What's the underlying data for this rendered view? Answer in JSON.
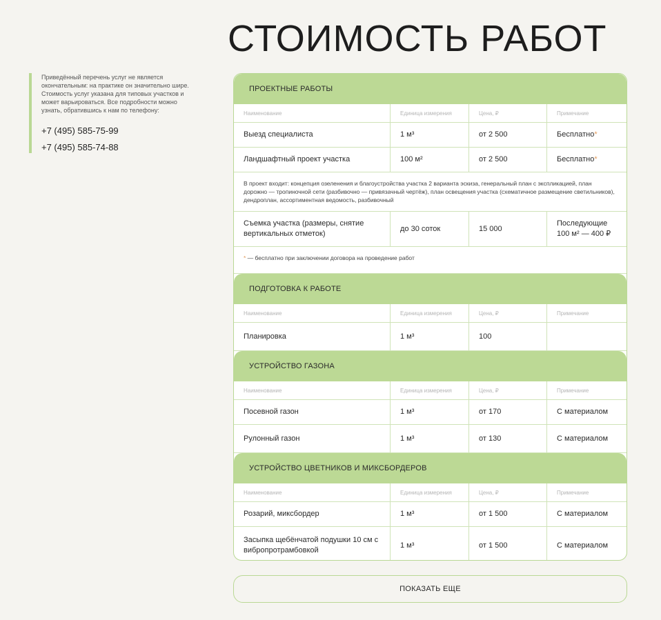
{
  "page": {
    "title": "СТОИМОСТЬ РАБОТ"
  },
  "note": {
    "text": "Приведённый перечень услуг не является окончательным: на практике он значительно шире. Стоимость услуг указана для типовых участков и может варьироваться. Все подробности можно узнать, обратившись к нам по телефону:",
    "phones": [
      "+7 (495) 585-75-99",
      "+7 (495) 585-74-88"
    ]
  },
  "table_headers": {
    "name": "Наименование",
    "unit": "Единица измерения",
    "price": "Цена, ₽",
    "note": "Примечание"
  },
  "sections": [
    {
      "title": "ПРОЕКТНЫЕ РАБОТЫ",
      "rows": [
        {
          "name": "Выезд специалиста",
          "unit": "1 м³",
          "price": "от 2 500",
          "note": "Бесплатно",
          "star": "*"
        },
        {
          "name": "Ландшафтный проект участка",
          "unit": "100 м²",
          "price": "от 2 500",
          "note": "Бесплатно",
          "star": "*"
        }
      ],
      "project_includes": "В проект входит: концепция озеленения и благоустройства участка 2 варианта эскиза, генеральный план с экспликацией, план дорожно — тропиночной сети (разбивочно — привязачный чертёж), план освещения участка (схематичное размещение светильников), дендроплан, ассортиментная ведомость, разбивочный",
      "survey_row": {
        "name": "Съемка участка (размеры, снятие вертикальных отметок)",
        "unit": "до 30 соток",
        "price": "15 000",
        "note": "Последующие 100 м² — 400 ₽"
      },
      "footnote_star": "*",
      "footnote": " — бесплатно при заключении договора на проведение работ"
    },
    {
      "title": "ПОДГОТОВКА К РАБОТЕ",
      "rows": [
        {
          "name": "Планировка",
          "unit": "1 м³",
          "price": "100",
          "note": ""
        }
      ]
    },
    {
      "title": "УСТРОЙСТВО ГАЗОНА",
      "rows": [
        {
          "name": "Посевной газон",
          "unit": "1 м³",
          "price": "от 170",
          "note": "С материалом"
        },
        {
          "name": "Рулонный газон",
          "unit": "1 м³",
          "price": "от 130",
          "note": "С материалом"
        }
      ]
    },
    {
      "title": "УСТРОЙСТВО ЦВЕТНИКОВ И МИКСБОРДЕРОВ",
      "rows": [
        {
          "name": "Розарий, миксбордер",
          "unit": "1 м³",
          "price": "от 1 500",
          "note": "С материалом"
        },
        {
          "name": "Засыпка щебёнчатой подушки 10 см с вибропротрамбовкой",
          "unit": "1 м³",
          "price": "от 1 500",
          "note": "С материалом"
        }
      ]
    }
  ],
  "show_more_label": "ПОКАЗАТЬ ЕЩЕ",
  "colors": {
    "accent": "#bcd995",
    "border": "#cfe3b7",
    "star": "#e29a5a",
    "background": "#f5f4f0"
  }
}
